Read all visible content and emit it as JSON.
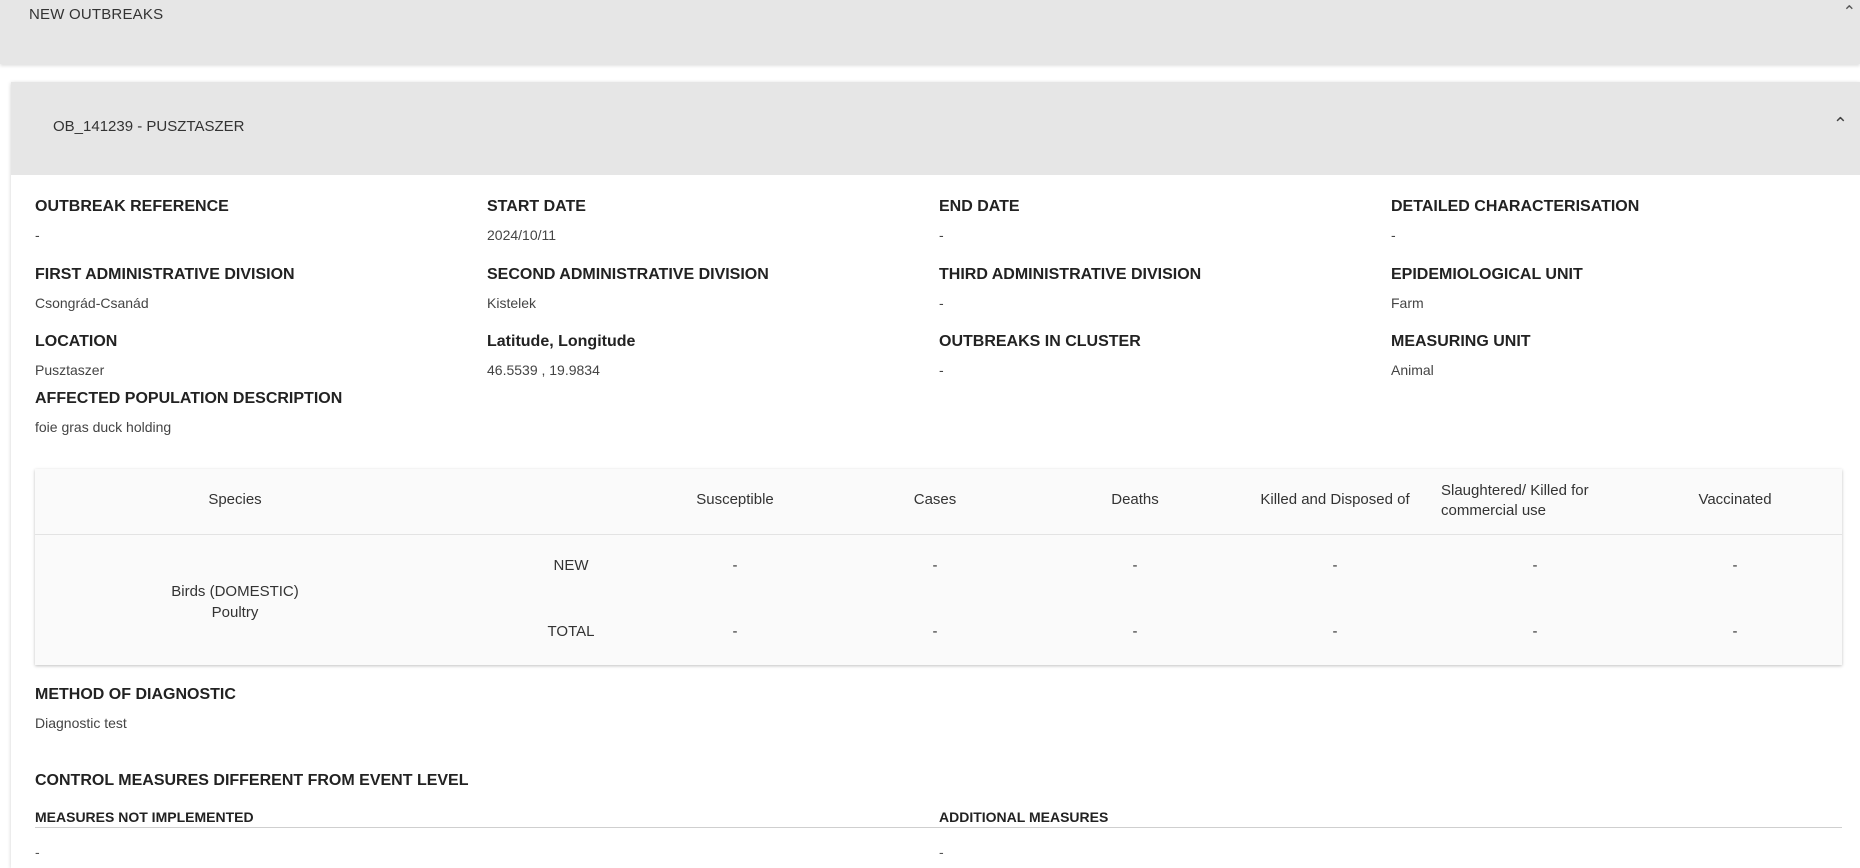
{
  "outer_panel": {
    "title": "NEW OUTBREAKS"
  },
  "outbreak_panel": {
    "title": "OB_141239 - PUSZTASZER"
  },
  "fields": {
    "outbreak_reference": {
      "label": "OUTBREAK REFERENCE",
      "value": "-"
    },
    "start_date": {
      "label": "START DATE",
      "value": "2024/10/11"
    },
    "end_date": {
      "label": "END DATE",
      "value": "-"
    },
    "detailed_characterisation": {
      "label": "DETAILED CHARACTERISATION",
      "value": "-"
    },
    "first_admin_division": {
      "label": "FIRST ADMINISTRATIVE DIVISION",
      "value": "Csongrád-Csanád"
    },
    "second_admin_division": {
      "label": "SECOND ADMINISTRATIVE DIVISION",
      "value": "Kistelek"
    },
    "third_admin_division": {
      "label": "THIRD ADMINISTRATIVE DIVISION",
      "value": "-"
    },
    "epidemiological_unit": {
      "label": "EPIDEMIOLOGICAL UNIT",
      "value": "Farm"
    },
    "location": {
      "label": "LOCATION",
      "value": "Pusztaszer"
    },
    "lat_long": {
      "label": "Latitude, Longitude",
      "value": "46.5539 , 19.9834"
    },
    "outbreaks_in_cluster": {
      "label": "OUTBREAKS IN CLUSTER",
      "value": "-"
    },
    "measuring_unit": {
      "label": "MEASURING UNIT",
      "value": "Animal"
    },
    "affected_population": {
      "label": "AFFECTED POPULATION DESCRIPTION",
      "value": "foie gras duck holding"
    }
  },
  "species_table": {
    "headers": {
      "species": "Species",
      "susceptible": "Susceptible",
      "cases": "Cases",
      "deaths": "Deaths",
      "killed_disposed": "Killed and Disposed of",
      "slaughtered_line1": "Slaughtered/ Killed for",
      "slaughtered_line2": "commercial use",
      "vaccinated": "Vaccinated"
    },
    "species_line1": "Birds (DOMESTIC)",
    "species_line2": "Poultry",
    "rows": [
      {
        "label": "NEW",
        "values": [
          "-",
          "-",
          "-",
          "-",
          "-",
          "-"
        ]
      },
      {
        "label": "TOTAL",
        "values": [
          "-",
          "-",
          "-",
          "-",
          "-",
          "-"
        ]
      }
    ]
  },
  "method_of_diagnostic": {
    "label": "METHOD OF DIAGNOSTIC",
    "value": "Diagnostic test"
  },
  "control_measures": {
    "title": "CONTROL MEASURES DIFFERENT FROM EVENT LEVEL",
    "not_implemented": {
      "label": "MEASURES NOT IMPLEMENTED",
      "value": "-"
    },
    "additional": {
      "label": "ADDITIONAL MEASURES",
      "value": "-"
    }
  }
}
